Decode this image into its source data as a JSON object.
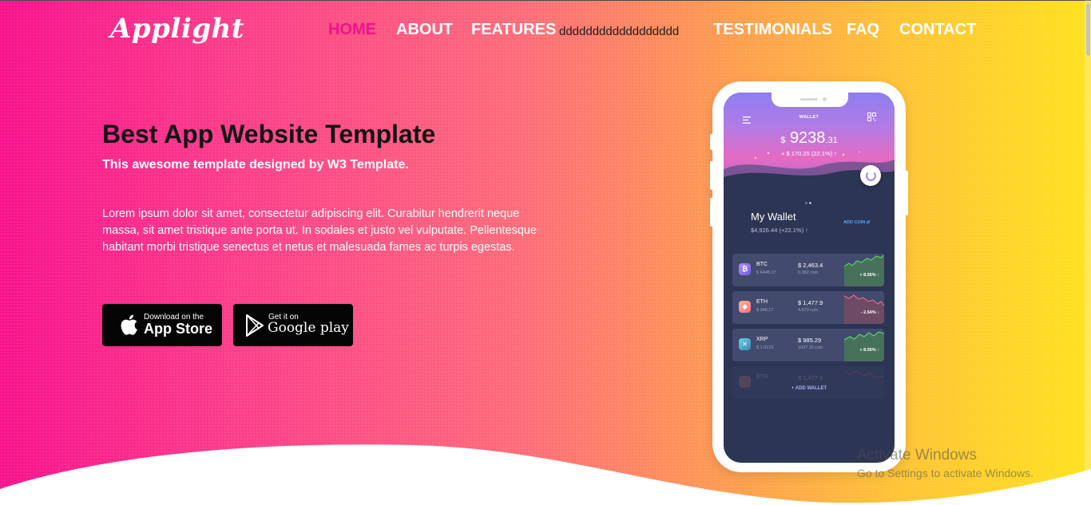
{
  "header": {
    "logo": "Applight",
    "nav": [
      {
        "label": "HOME",
        "active": true
      },
      {
        "label": "ABOUT"
      },
      {
        "label": "FEATURES"
      },
      {
        "label": "dddddddddddddddddd"
      },
      {
        "label": "TESTIMONIALS"
      },
      {
        "label": "FAQ"
      },
      {
        "label": "CONTACT"
      }
    ]
  },
  "hero": {
    "title": "Best App Website Template",
    "subtitle": "This awesome template designed by W3 Template.",
    "description": "Lorem ipsum dolor sit amet, consectetur adipiscing elit. Curabitur hendrerit neque massa, sit amet tristique ante porta ut. In sodales et justo vel vulputate. Pellentesque habitant morbi tristique senectus et netus et malesuada fames ac turpis egestas.",
    "app_store": {
      "small": "Download on the",
      "big": "App Store"
    },
    "google_play": {
      "small": "Get it on",
      "big": "Google play"
    }
  },
  "phone": {
    "header_title": "WALLET",
    "balance_currency": "$",
    "balance_main": "9238",
    "balance_cents": ".31",
    "balance_change": "+ $ 170.25 (22.1%) ↑",
    "my_wallet": "My Wallet",
    "wallet_total": "$4,926.44 (+22.1%) ↑",
    "add_coin": "ADD COIN",
    "coins": [
      {
        "symbol": "BTC",
        "amount": "$ 6448.17",
        "price": "$ 2,463.4",
        "units": "0.382 coin",
        "change": "+ 8.56% ↑",
        "color": "#9a7cf0",
        "trend": "up"
      },
      {
        "symbol": "ETH",
        "amount": "$ 346.17",
        "price": "$ 1,477.9",
        "units": "4.879 coin",
        "change": "- 2.54% ↓",
        "color": "#ff8a7c",
        "trend": "down"
      },
      {
        "symbol": "XRP",
        "amount": "$ 1.0123",
        "price": "$ 985.29",
        "units": "1037.15 coin",
        "change": "+ 8.56% ↑",
        "color": "#4aa6c8",
        "trend": "up"
      },
      {
        "symbol": "ETH",
        "amount": "",
        "price": "$ 1,477.9",
        "units": "",
        "change": "",
        "color": "#ff8a7c",
        "trend": "down"
      }
    ],
    "add_wallet": "+ ADD WALLET"
  },
  "overlay": {
    "activate_title": "Activate Windows",
    "activate_sub": "Go to Settings to activate Windows."
  },
  "colors": {
    "gradient_start": "#f7138d",
    "gradient_end": "#ffe21f",
    "active_nav": "#f0128a",
    "up": "#5fe36a",
    "down": "#ff6f8a"
  }
}
